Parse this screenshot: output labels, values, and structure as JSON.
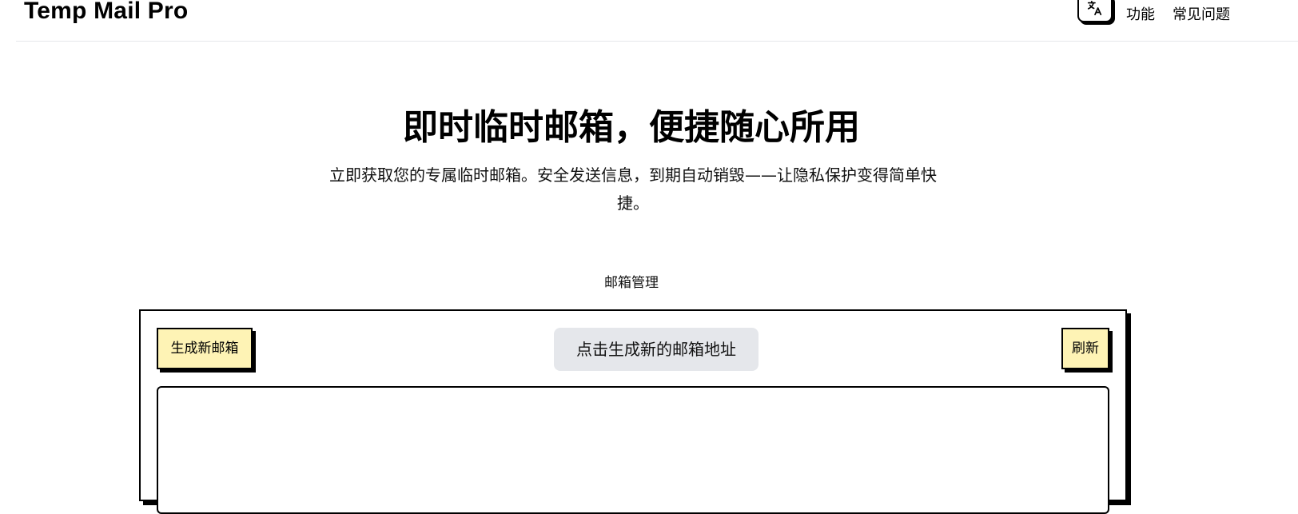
{
  "header": {
    "brand": "Temp Mail Pro",
    "nav": [
      {
        "label": "功能"
      },
      {
        "label": "常见问题"
      }
    ],
    "language_icon": "translate-icon"
  },
  "hero": {
    "title": "即时临时邮箱，便捷随心所用",
    "subtitle": "立即获取您的专属临时邮箱。安全发送信息，到期自动销毁——让隐私保护变得简单快捷。"
  },
  "mailbox": {
    "section_label": "邮箱管理",
    "generate_label": "生成新邮箱",
    "address_text": "点击生成新的邮箱地址",
    "refresh_label": "刷新"
  },
  "colors": {
    "button_yellow": "#fef3b5",
    "address_gray": "#e5e7eb"
  }
}
